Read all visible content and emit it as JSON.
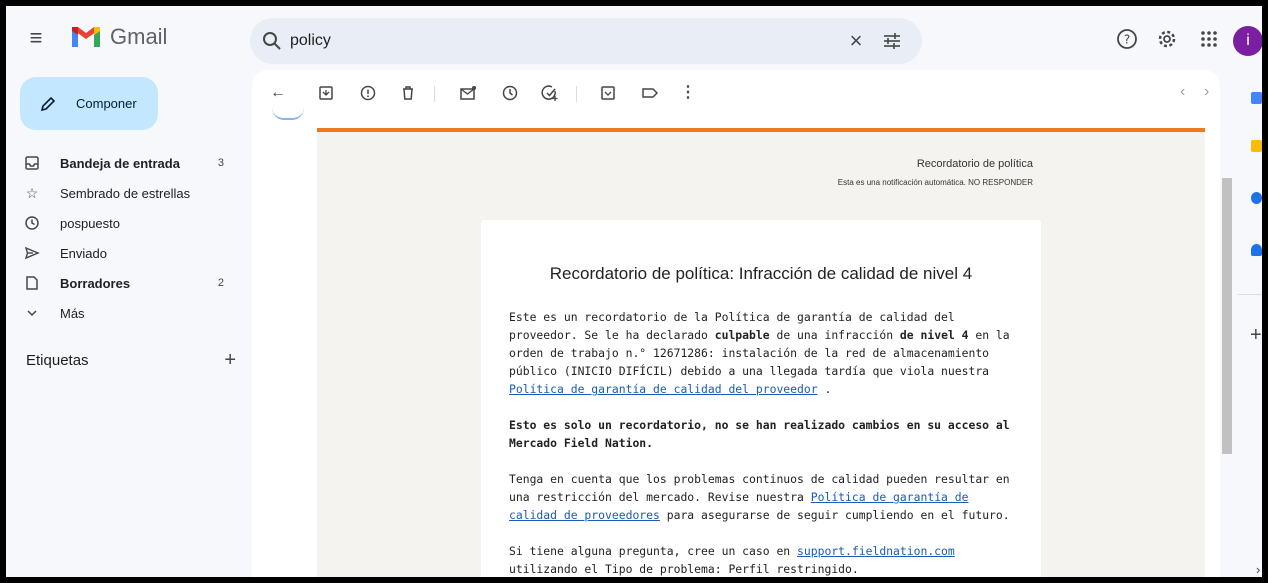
{
  "app": {
    "name": "Gmail"
  },
  "search": {
    "query": "policy"
  },
  "compose": {
    "label": "Componer"
  },
  "sidebar": {
    "items": [
      {
        "label": "Bandeja de entrada",
        "count": "3",
        "bold": true
      },
      {
        "label": "Sembrado de estrellas",
        "count": "",
        "bold": false
      },
      {
        "label": "pospuesto",
        "count": "",
        "bold": false
      },
      {
        "label": "Enviado",
        "count": "",
        "bold": false
      },
      {
        "label": "Borradores",
        "count": "2",
        "bold": true
      },
      {
        "label": "Más",
        "count": "",
        "bold": false
      }
    ],
    "labels_title": "Etiquetas"
  },
  "profile": {
    "initial": "i"
  },
  "email": {
    "header_title": "Recordatorio de política",
    "header_subtitle": "Esta es una notificación automática. NO RESPONDER",
    "title": "Recordatorio de política: Infracción de calidad de nivel 4",
    "p1_a": "Este es un recordatorio de la Política de garantía de calidad del proveedor. Se le ha declarado ",
    "p1_b": "culpable",
    "p1_c": " de una infracción ",
    "p1_d": "de nivel 4",
    "p1_e": " en la orden de trabajo n.° 12671286: instalación de la red de almacenamiento público (INICIO DIFÍCIL) debido a una llegada tardía que viola nuestra ",
    "p1_link": "Política de garantía de calidad del proveedor",
    "p1_f": " .",
    "p2": "Esto es solo un recordatorio, no se han realizado cambios en su acceso al Mercado Field Nation.",
    "p3_a": "Tenga en cuenta que los problemas continuos de calidad pueden resultar en una restricción del mercado. Revise nuestra ",
    "p3_link": "Política de garantía de calidad de proveedores",
    "p3_b": " para asegurarse de seguir cumpliendo en el futuro.",
    "p4_a": "Si tiene alguna pregunta, cree un caso en ",
    "p4_link": "support.fieldnation.com",
    "p4_b": " utilizando el Tipo de problema: Perfil restringido."
  },
  "icons": {
    "menu": "menu-icon",
    "search": "search-icon",
    "clear": "close-icon",
    "filter": "tune-icon",
    "help": "help-icon",
    "settings": "gear-icon",
    "apps": "apps-grid-icon"
  },
  "colors": {
    "accent": "#f0791e",
    "compose_bg": "#c2e7ff",
    "link": "#1a5bb8"
  }
}
